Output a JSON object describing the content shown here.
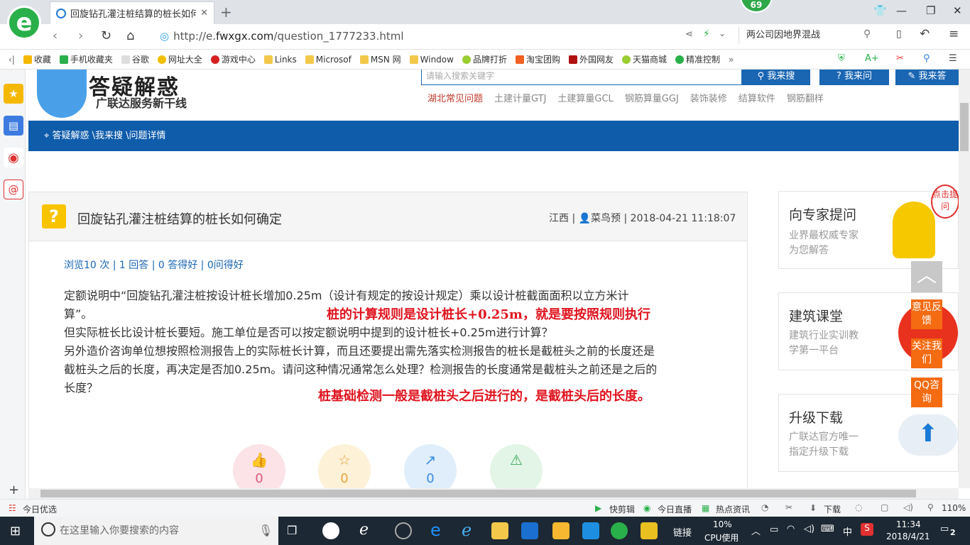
{
  "browser": {
    "tab_title": "回旋钻孔灌注桩结算的桩长如何确",
    "new_tab": "+",
    "badge": "69",
    "url_prefix": "http://e.",
    "url_domain": "fwxgx.com",
    "url_path": "/question_1777233.html",
    "search_text": "两公司因地界混战",
    "zoom": "110%"
  },
  "bookmarks": [
    "收藏",
    "手机收藏夹",
    "谷歌",
    "网址大全",
    "游戏中心",
    "Links",
    "Microsof",
    "MSN 网",
    "Window",
    "品牌打折",
    "淘宝团购",
    "外国网友",
    "天猫商城",
    "精准控制"
  ],
  "site": {
    "title": "答疑解惑",
    "subtitle": "广联达服务新干线",
    "search_placeholder": "请输入搜索关键字",
    "btn_search": "我来搜",
    "btn_ask": "我来问",
    "btn_answer": "我来答",
    "hot_links": [
      "湖北常见问题",
      "土建计量GTJ",
      "土建算量GCL",
      "钢筋算量GGJ",
      "装饰装修",
      "结算软件",
      "钢筋翻样"
    ],
    "breadcrumb": "答疑解惑 \\我来搜 \\问题详情"
  },
  "question": {
    "title": "回旋钻孔灌注桩结算的桩长如何确定",
    "meta": "江西 | 👤菜鸟预 | 2018-04-21 11:18:07",
    "stats": "浏览10 次 | 1 回答 | 0 答得好 | 0问得好",
    "line1": "定额说明中“回旋钻孔灌注桩按设计桩长增加0.25m（设计有规定的按设计规定）乘以设计桩截面面积以立方米计",
    "line2": "算”。",
    "line3": "但实际桩长比设计桩长要短。施工单位是否可以按定额说明中提到的设计桩长+0.25m进行计算？",
    "line4": "另外造价咨询单位想按照检测报告上的实际桩长计算，而且还要提出需先落实检测报告的桩长是截桩头之前的长度还是",
    "line5": "截桩头之后的长度，再决定是否加0.25m。请问这种情况通常怎么处理？检测报告的长度通常是截桩头之前还是之后的",
    "line6": "长度？",
    "annotation1": "桩的计算规则是设计桩长+0.25m，就是要按照规则执行",
    "annotation2": "桩基础检测一般是截桩头之后进行的，是截桩头后的长度。",
    "actions": [
      {
        "icon": "👍",
        "count": "0",
        "color": "#fbe3e8",
        "fg": "#e05a78"
      },
      {
        "icon": "☆",
        "count": "0",
        "color": "#fdf1d8",
        "fg": "#e8a53a"
      },
      {
        "icon": "↗",
        "count": "0",
        "color": "#e0eefb",
        "fg": "#3a8be0"
      },
      {
        "icon": "⚠",
        "count": "",
        "color": "#e3f5e6",
        "fg": "#3aa85a"
      }
    ]
  },
  "sidebar": {
    "expert_title": "向专家提问",
    "expert_desc1": "业界最权威专家",
    "expert_desc2": "为您解答",
    "expert_bubble": "点击提问",
    "course_title": "建筑课堂",
    "course_desc1": "建筑行业实训教",
    "course_desc2": "学第一平台",
    "upgrade_title": "升级下载",
    "upgrade_desc1": "广联达官方唯一",
    "upgrade_desc2": "指定升级下载",
    "feedback": "意见反馈",
    "follow": "关注我们",
    "qq": "QQ咨询"
  },
  "statusbar": {
    "left": "今日优选",
    "items": [
      "快剪辑",
      "今日直播",
      "热点资讯",
      "下载"
    ]
  },
  "taskbar": {
    "search_placeholder": "在这里输入你要搜索的内容",
    "links": "链接",
    "cpu_pct": "10%",
    "cpu_label": "CPU使用",
    "ime": "中",
    "time": "11:34",
    "date": "2018/4/21",
    "notif": "2"
  },
  "colors": {
    "brand_blue": "#0f5cab",
    "orange": "#f46b12",
    "annotation_red": "#e0141e"
  }
}
